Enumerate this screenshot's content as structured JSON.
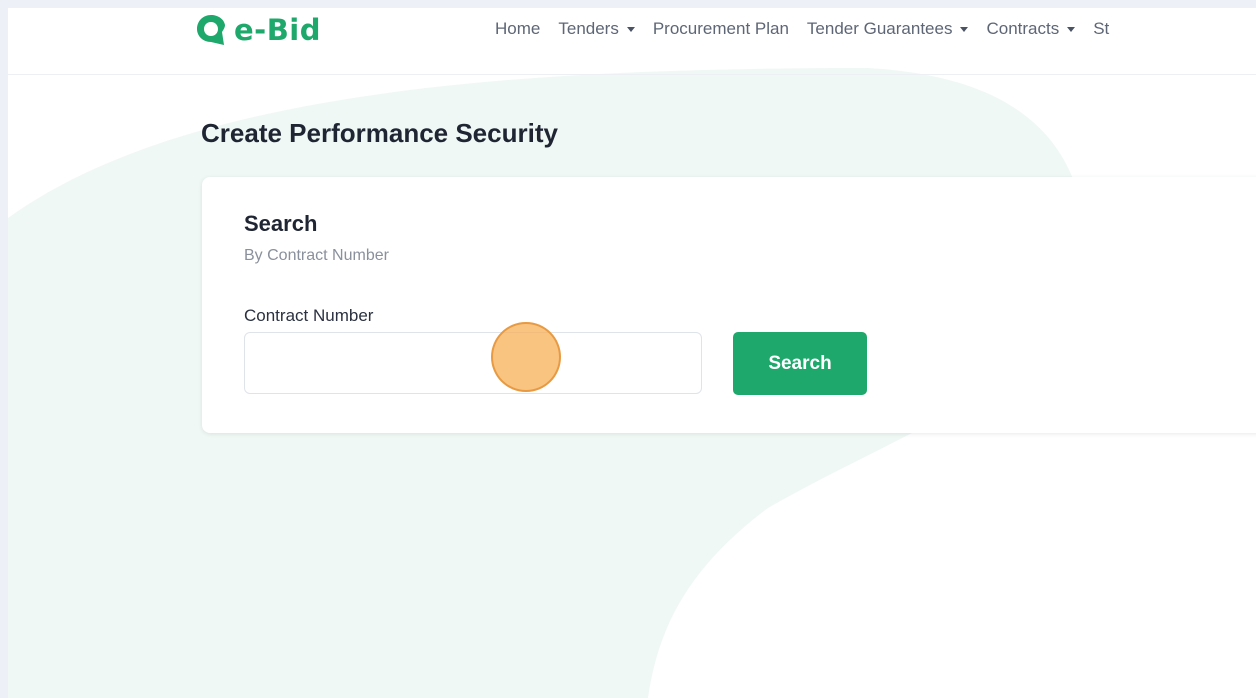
{
  "colors": {
    "brand": "#1ea86b",
    "background_blob": "#f0f8f5",
    "text_dark": "#1f2533",
    "text_nav": "#5e6676",
    "click_marker": "#f7b25c"
  },
  "header": {
    "logo_icon": "map-pin-icon",
    "logo_text": "e-Bid",
    "nav": [
      {
        "label": "Home",
        "has_dropdown": false
      },
      {
        "label": "Tenders",
        "has_dropdown": true
      },
      {
        "label": "Procurement Plan",
        "has_dropdown": false
      },
      {
        "label": "Tender Guarantees",
        "has_dropdown": true
      },
      {
        "label": "Contracts",
        "has_dropdown": true
      },
      {
        "label": "St",
        "has_dropdown": false
      }
    ]
  },
  "page": {
    "title": "Create Performance Security"
  },
  "search_card": {
    "title": "Search",
    "subtitle": "By Contract Number",
    "field_label": "Contract Number",
    "field_value": "",
    "button_label": "Search"
  }
}
